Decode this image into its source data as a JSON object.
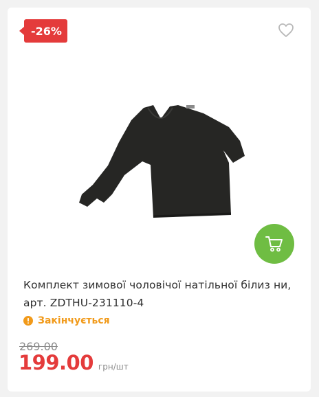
{
  "product": {
    "discount": "-26%",
    "title": "Комплект зимової чоловічої натільної білиз ни, арт. ZDTHU-231110-4",
    "stock_status": "Закінчується",
    "old_price": "269.00",
    "price": "199.00",
    "unit": "грн/шт"
  },
  "icons": {
    "favorite": "heart-outline-icon",
    "cart": "cart-icon",
    "stock": "exclamation-circle-icon"
  },
  "colors": {
    "badge": "#e43b3b",
    "price": "#e43b3b",
    "cart_button": "#6fbd43",
    "stock_warning": "#f19a1a",
    "product_garment": "#262624"
  }
}
